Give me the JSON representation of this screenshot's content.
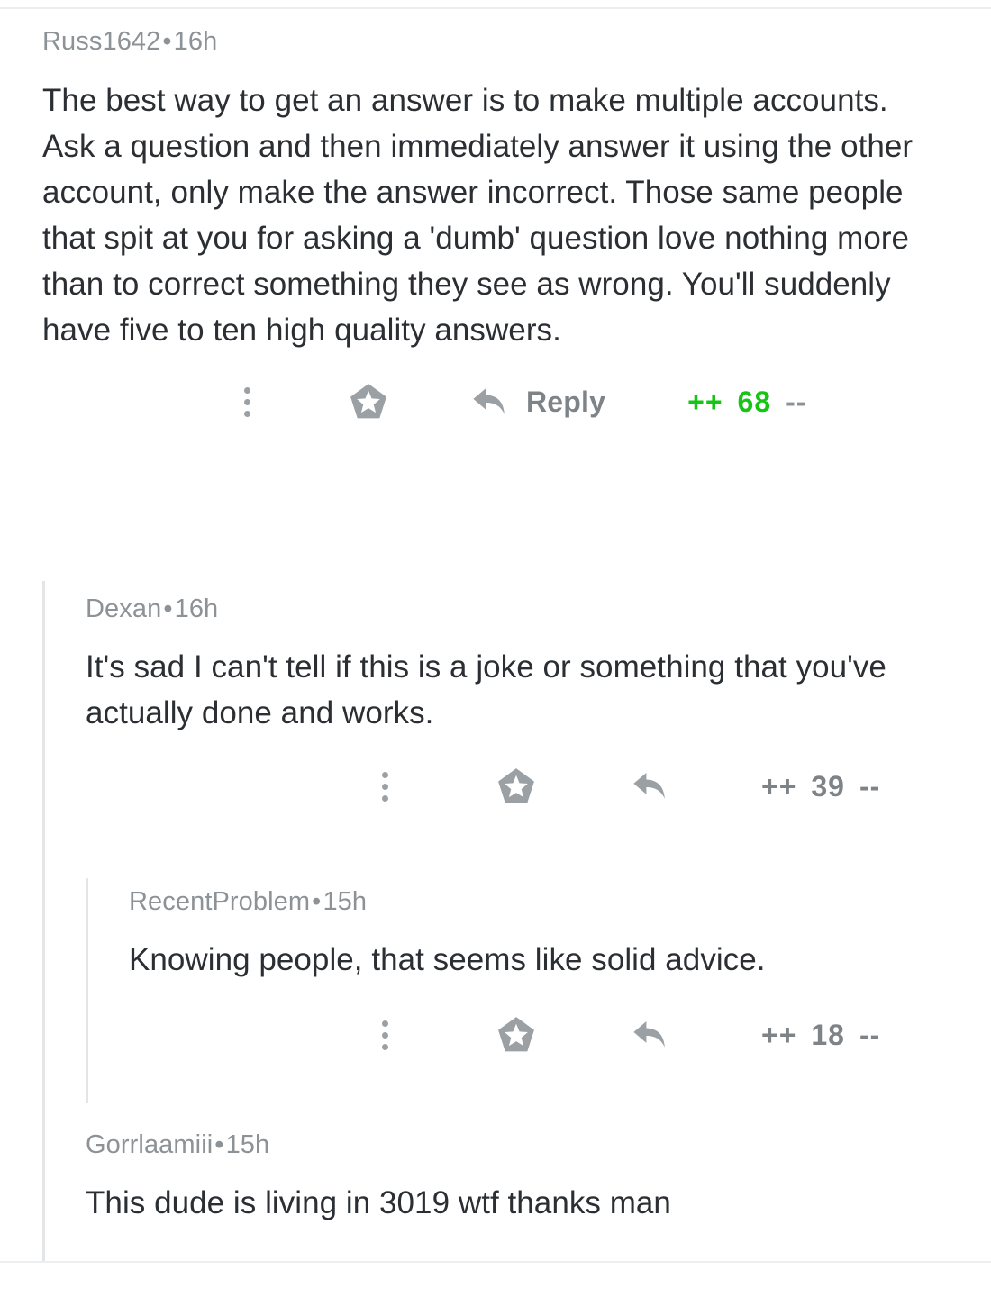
{
  "theme": {
    "background": "#ffffff",
    "text_color": "#2b2f33",
    "meta_color": "#8c9296",
    "action_color": "#7d8387",
    "upvote_green": "#15c415",
    "rail_color": "#e3e5e6",
    "divider_color": "#eceeef"
  },
  "comments": [
    {
      "id": "c1",
      "author": "Russ1642",
      "separator": "•",
      "age": "16h",
      "depth": 0,
      "body": "The best way to get an answer is to make multiple accounts. Ask a question and then immediately answer it using the other account, only make the answer incorrect. Those same people that spit at you for asking a 'dumb' question love nothing more than to correct something they see as wrong. You'll suddenly have five to ten high quality answers.",
      "actions": {
        "more_icon": "kebab-menu-icon",
        "award_icon": "award-pentagon-star-icon",
        "reply_icon": "reply-arrow-icon",
        "reply_label": "Reply",
        "upvote_label": "++",
        "score": "68",
        "downvote_label": "--",
        "upvoted": true
      }
    },
    {
      "id": "c2",
      "author": "Dexan",
      "separator": "•",
      "age": "16h",
      "depth": 1,
      "body": "It's sad I can't tell if this is a joke or something that you've actually done and works.",
      "actions": {
        "more_icon": "kebab-menu-icon",
        "award_icon": "award-pentagon-star-icon",
        "reply_icon": "reply-arrow-icon",
        "reply_label": "",
        "upvote_label": "++",
        "score": "39",
        "downvote_label": "--",
        "upvoted": false
      }
    },
    {
      "id": "c3",
      "author": "RecentProblem",
      "separator": "•",
      "age": "15h",
      "depth": 2,
      "body": "Knowing people, that seems like solid advice.",
      "actions": {
        "more_icon": "kebab-menu-icon",
        "award_icon": "award-pentagon-star-icon",
        "reply_icon": "reply-arrow-icon",
        "reply_label": "",
        "upvote_label": "++",
        "score": "18",
        "downvote_label": "--",
        "upvoted": false
      }
    },
    {
      "id": "c4",
      "author": "Gorrlaamiii",
      "separator": "•",
      "age": "15h",
      "depth": 1,
      "body": "This dude is living in 3019 wtf thanks man",
      "actions": null
    }
  ]
}
